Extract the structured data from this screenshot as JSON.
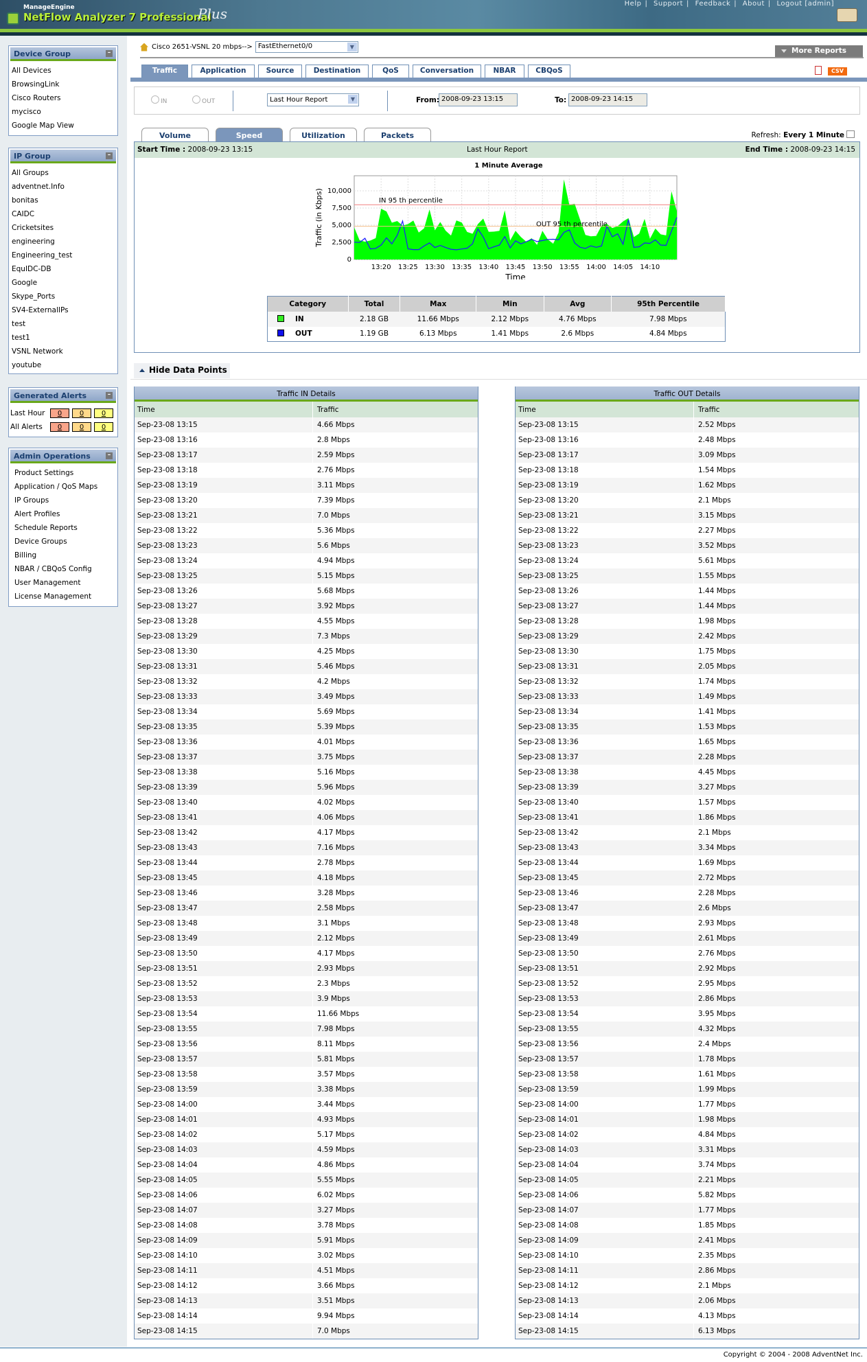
{
  "header": {
    "brand": "ManageEngine",
    "product": "NetFlow Analyzer 7 Professional",
    "edition": "Plus",
    "links": [
      "Help",
      "Support",
      "Feedback",
      "About",
      "Logout [admin]"
    ]
  },
  "sidebar": {
    "device_group": {
      "title": "Device Group",
      "items": [
        "All Devices",
        "BrowsingLink",
        "Cisco Routers",
        "mycisco",
        "Google Map View"
      ]
    },
    "ip_group": {
      "title": "IP Group",
      "items": [
        "All Groups",
        "adventnet.Info",
        "bonitas",
        "CAIDC",
        "Cricketsites",
        "engineering",
        "Engineering_test",
        "EquIDC-DB",
        "Google",
        "Skype_Ports",
        "SV4-ExternalIPs",
        "test",
        "test1",
        "VSNL Network",
        "youtube"
      ]
    },
    "alerts": {
      "title": "Generated Alerts",
      "rows": [
        {
          "label": "Last Hour",
          "counts": [
            "0",
            "0",
            "0"
          ]
        },
        {
          "label": "All Alerts",
          "counts": [
            "0",
            "0",
            "0"
          ]
        }
      ],
      "colors": [
        "#f9a58a",
        "#ffd98a",
        "#ffff80"
      ]
    },
    "admin": {
      "title": "Admin Operations",
      "items": [
        "Product Settings",
        "Application / QoS Maps",
        "IP Groups",
        "Alert Profiles",
        "Schedule Reports",
        "Device Groups",
        "Billing",
        "NBAR / CBQoS Config",
        "User Management",
        "License Management"
      ]
    }
  },
  "device": {
    "label": "Cisco 2651-VSNL 20 mbps-->",
    "interface": "FastEthernet0/0"
  },
  "more_reports": "More Reports",
  "tabs": [
    "Traffic",
    "Application",
    "Source",
    "Destination",
    "QoS",
    "Conversation",
    "NBAR",
    "CBQoS"
  ],
  "csv": "CSV",
  "filter": {
    "in": "IN",
    "out": "OUT",
    "report": "Last Hour Report",
    "from_label": "From:",
    "from": "2008-09-23 13:15",
    "to_label": "To:",
    "to": "2008-09-23 14:15"
  },
  "subtabs": [
    "Volume",
    "Speed",
    "Utilization",
    "Packets"
  ],
  "refresh": {
    "label": "Refresh:",
    "value": "Every 1 Minute"
  },
  "report": {
    "start_label": "Start Time :",
    "start": "2008-09-23 13:15",
    "title": "Last Hour Report",
    "end_label": "End Time :",
    "end": "2008-09-23 14:15"
  },
  "summary": {
    "headers": [
      "Category",
      "Total",
      "Max",
      "Min",
      "Avg",
      "95th Percentile"
    ],
    "rows": [
      {
        "name": "IN",
        "color": "#33ee22",
        "total": "2.18 GB",
        "max": "11.66 Mbps",
        "min": "2.12 Mbps",
        "avg": "4.76 Mbps",
        "p95": "7.98 Mbps"
      },
      {
        "name": "OUT",
        "color": "#1010ee",
        "total": "1.19 GB",
        "max": "6.13 Mbps",
        "min": "1.41 Mbps",
        "avg": "2.6 Mbps",
        "p95": "4.84 Mbps"
      }
    ]
  },
  "hide_points": "Hide Data Points",
  "details": {
    "in_title": "Traffic IN Details",
    "out_title": "Traffic OUT Details",
    "col_time": "Time",
    "col_traffic": "Traffic",
    "times": [
      "Sep-23-08 13:15",
      "Sep-23-08 13:16",
      "Sep-23-08 13:17",
      "Sep-23-08 13:18",
      "Sep-23-08 13:19",
      "Sep-23-08 13:20",
      "Sep-23-08 13:21",
      "Sep-23-08 13:22",
      "Sep-23-08 13:23",
      "Sep-23-08 13:24",
      "Sep-23-08 13:25",
      "Sep-23-08 13:26",
      "Sep-23-08 13:27",
      "Sep-23-08 13:28",
      "Sep-23-08 13:29",
      "Sep-23-08 13:30",
      "Sep-23-08 13:31",
      "Sep-23-08 13:32",
      "Sep-23-08 13:33",
      "Sep-23-08 13:34",
      "Sep-23-08 13:35",
      "Sep-23-08 13:36",
      "Sep-23-08 13:37",
      "Sep-23-08 13:38",
      "Sep-23-08 13:39",
      "Sep-23-08 13:40",
      "Sep-23-08 13:41",
      "Sep-23-08 13:42",
      "Sep-23-08 13:43",
      "Sep-23-08 13:44",
      "Sep-23-08 13:45",
      "Sep-23-08 13:46",
      "Sep-23-08 13:47",
      "Sep-23-08 13:48",
      "Sep-23-08 13:49",
      "Sep-23-08 13:50",
      "Sep-23-08 13:51",
      "Sep-23-08 13:52",
      "Sep-23-08 13:53",
      "Sep-23-08 13:54",
      "Sep-23-08 13:55",
      "Sep-23-08 13:56",
      "Sep-23-08 13:57",
      "Sep-23-08 13:58",
      "Sep-23-08 13:59",
      "Sep-23-08 14:00",
      "Sep-23-08 14:01",
      "Sep-23-08 14:02",
      "Sep-23-08 14:03",
      "Sep-23-08 14:04",
      "Sep-23-08 14:05",
      "Sep-23-08 14:06",
      "Sep-23-08 14:07",
      "Sep-23-08 14:08",
      "Sep-23-08 14:09",
      "Sep-23-08 14:10",
      "Sep-23-08 14:11",
      "Sep-23-08 14:12",
      "Sep-23-08 14:13",
      "Sep-23-08 14:14",
      "Sep-23-08 14:15"
    ],
    "in_values": [
      "4.66 Mbps",
      "2.8 Mbps",
      "2.59 Mbps",
      "2.76 Mbps",
      "3.11 Mbps",
      "7.39 Mbps",
      "7.0 Mbps",
      "5.36 Mbps",
      "5.6 Mbps",
      "4.94 Mbps",
      "5.15 Mbps",
      "5.68 Mbps",
      "3.92 Mbps",
      "4.55 Mbps",
      "7.3 Mbps",
      "4.25 Mbps",
      "5.46 Mbps",
      "4.2 Mbps",
      "3.49 Mbps",
      "5.69 Mbps",
      "5.39 Mbps",
      "4.01 Mbps",
      "3.75 Mbps",
      "5.16 Mbps",
      "5.96 Mbps",
      "4.02 Mbps",
      "4.06 Mbps",
      "4.17 Mbps",
      "7.16 Mbps",
      "2.78 Mbps",
      "4.18 Mbps",
      "3.28 Mbps",
      "2.58 Mbps",
      "3.1 Mbps",
      "2.12 Mbps",
      "4.17 Mbps",
      "2.93 Mbps",
      "2.3 Mbps",
      "3.9 Mbps",
      "11.66 Mbps",
      "7.98 Mbps",
      "8.11 Mbps",
      "5.81 Mbps",
      "3.57 Mbps",
      "3.38 Mbps",
      "3.44 Mbps",
      "4.93 Mbps",
      "5.17 Mbps",
      "4.59 Mbps",
      "4.86 Mbps",
      "5.55 Mbps",
      "6.02 Mbps",
      "3.27 Mbps",
      "3.78 Mbps",
      "5.91 Mbps",
      "3.02 Mbps",
      "4.51 Mbps",
      "3.66 Mbps",
      "3.51 Mbps",
      "9.94 Mbps",
      "7.0 Mbps"
    ],
    "out_values": [
      "2.52 Mbps",
      "2.48 Mbps",
      "3.09 Mbps",
      "1.54 Mbps",
      "1.62 Mbps",
      "2.1 Mbps",
      "3.15 Mbps",
      "2.27 Mbps",
      "3.52 Mbps",
      "5.61 Mbps",
      "1.55 Mbps",
      "1.44 Mbps",
      "1.44 Mbps",
      "1.98 Mbps",
      "2.42 Mbps",
      "1.75 Mbps",
      "2.05 Mbps",
      "1.74 Mbps",
      "1.49 Mbps",
      "1.41 Mbps",
      "1.53 Mbps",
      "1.65 Mbps",
      "2.28 Mbps",
      "4.45 Mbps",
      "3.27 Mbps",
      "1.57 Mbps",
      "1.86 Mbps",
      "2.1 Mbps",
      "3.34 Mbps",
      "1.69 Mbps",
      "2.72 Mbps",
      "2.28 Mbps",
      "2.6 Mbps",
      "2.93 Mbps",
      "2.61 Mbps",
      "2.76 Mbps",
      "2.92 Mbps",
      "2.95 Mbps",
      "2.86 Mbps",
      "3.95 Mbps",
      "4.32 Mbps",
      "2.4 Mbps",
      "1.78 Mbps",
      "1.61 Mbps",
      "1.99 Mbps",
      "1.77 Mbps",
      "1.98 Mbps",
      "4.84 Mbps",
      "3.31 Mbps",
      "3.74 Mbps",
      "2.21 Mbps",
      "5.82 Mbps",
      "1.77 Mbps",
      "1.85 Mbps",
      "2.41 Mbps",
      "2.35 Mbps",
      "2.86 Mbps",
      "2.1 Mbps",
      "2.06 Mbps",
      "4.13 Mbps",
      "6.13 Mbps"
    ]
  },
  "chart_data": {
    "type": "area",
    "title": "1 Minute Average",
    "xlabel": "Time",
    "ylabel": "Traffic (in Kbps)",
    "ylim": [
      0,
      12200
    ],
    "yticks": [
      "0",
      "2,500",
      "5,000",
      "7,500",
      "10,000"
    ],
    "ytick_values": [
      0,
      2500,
      5000,
      7500,
      10000
    ],
    "xticks": [
      "13:20",
      "13:25",
      "13:30",
      "13:35",
      "13:40",
      "13:45",
      "13:50",
      "13:55",
      "14:00",
      "14:05",
      "14:10"
    ],
    "xtick_minutes": [
      5,
      10,
      15,
      20,
      25,
      30,
      35,
      40,
      45,
      50,
      55
    ],
    "grid": true,
    "series": [
      {
        "name": "IN",
        "type": "area",
        "color": "#00ff00"
      },
      {
        "name": "OUT",
        "type": "line",
        "color": "#1a1aff"
      }
    ],
    "note": "series values in Kbps = details values x 1000, one per minute 13:15-14:15",
    "thresholds": [
      {
        "label": "IN 95 th percentile",
        "value": 7980,
        "color": "#f08080"
      },
      {
        "label": "OUT 95 th percentile",
        "value": 4840,
        "color": "#f5c08a"
      }
    ]
  },
  "footer": "Copyright © 2004 - 2008 AdventNet Inc."
}
